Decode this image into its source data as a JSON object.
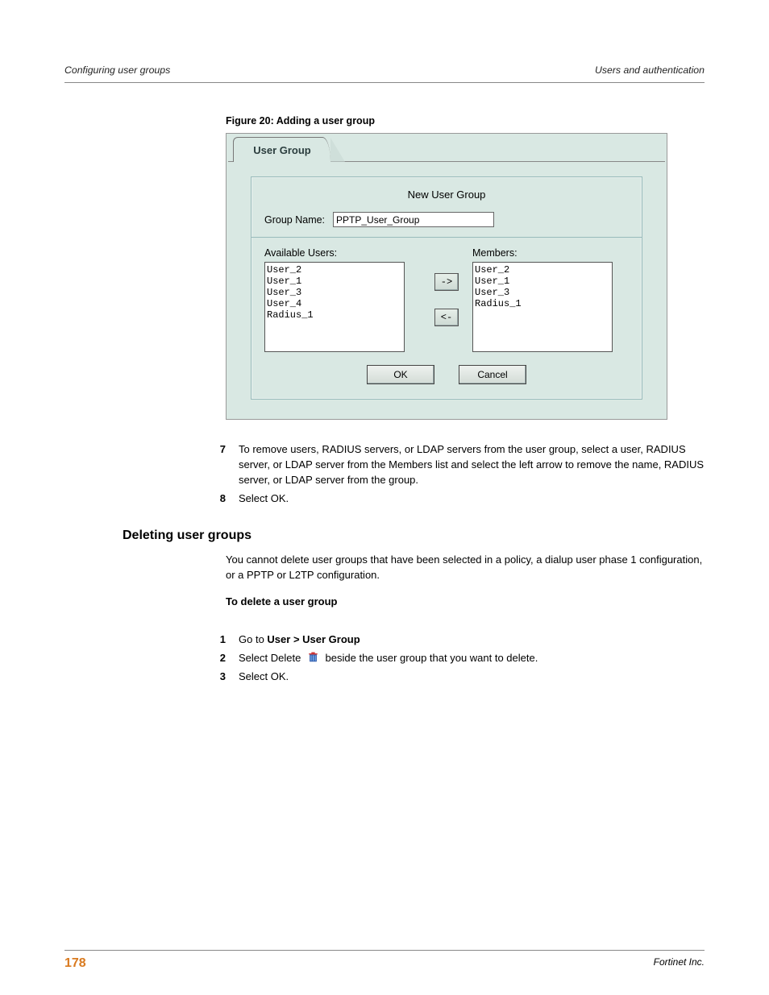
{
  "header": {
    "left": "Configuring user groups",
    "right": "Users and authentication"
  },
  "figure_caption": "Figure 20: Adding a user group",
  "dialog": {
    "tab": "User Group",
    "title": "New User Group",
    "group_name_label": "Group Name:",
    "group_name_value": "PPTP_User_Group",
    "available_label": "Available Users:",
    "members_label": "Members:",
    "available": [
      "User_2",
      "User_1",
      "User_3",
      "User_4",
      "Radius_1"
    ],
    "members": [
      "User_2",
      "User_1",
      "User_3",
      "Radius_1"
    ],
    "btn_right": "->",
    "btn_left": "<-",
    "ok": "OK",
    "cancel": "Cancel"
  },
  "steps_first": [
    {
      "n": "7",
      "t": "To remove users, RADIUS servers, or LDAP servers from the user group, select a user, RADIUS server, or LDAP server from the Members list and select the left arrow to remove the name, RADIUS server, or LDAP server from the group."
    },
    {
      "n": "8",
      "t": "Select OK."
    }
  ],
  "section_heading": "Deleting user groups",
  "section_para": "You cannot delete user groups that have been selected in a policy, a dialup user phase 1 configuration, or a PPTP or L2TP configuration.",
  "subheading": "To delete a user group",
  "steps_second": [
    {
      "n": "1",
      "pre": "Go to ",
      "bold": "User > User Group",
      "post": ""
    },
    {
      "n": "2",
      "pre": "Select Delete ",
      "post": " beside the user group that you want to delete.",
      "icon": true
    },
    {
      "n": "3",
      "pre": "Select OK.",
      "post": ""
    }
  ],
  "footer": {
    "page": "178",
    "right": "Fortinet Inc."
  }
}
